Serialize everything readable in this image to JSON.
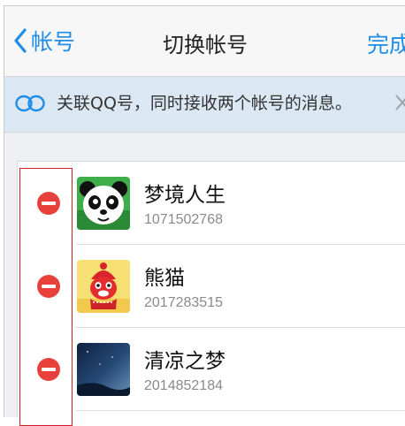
{
  "navbar": {
    "back_label": "帐号",
    "title": "切换帐号",
    "done_label": "完成",
    "accent_color": "#1f8ce6"
  },
  "banner": {
    "text": "关联QQ号，同时接收两个帐号的消息。",
    "icon": "link-icon",
    "close_icon": "close-icon"
  },
  "accounts": [
    {
      "nickname": "梦境人生",
      "number": "1071502768",
      "avatar": "panda-avatar"
    },
    {
      "nickname": "熊猫",
      "number": "2017283515",
      "avatar": "red-mascot-avatar"
    },
    {
      "nickname": "清凉之梦",
      "number": "2014852184",
      "avatar": "night-sky-avatar"
    }
  ],
  "colors": {
    "remove": "#e8413c",
    "highlight": "#d21f1f",
    "banner_bg": "#dbe8f3"
  }
}
